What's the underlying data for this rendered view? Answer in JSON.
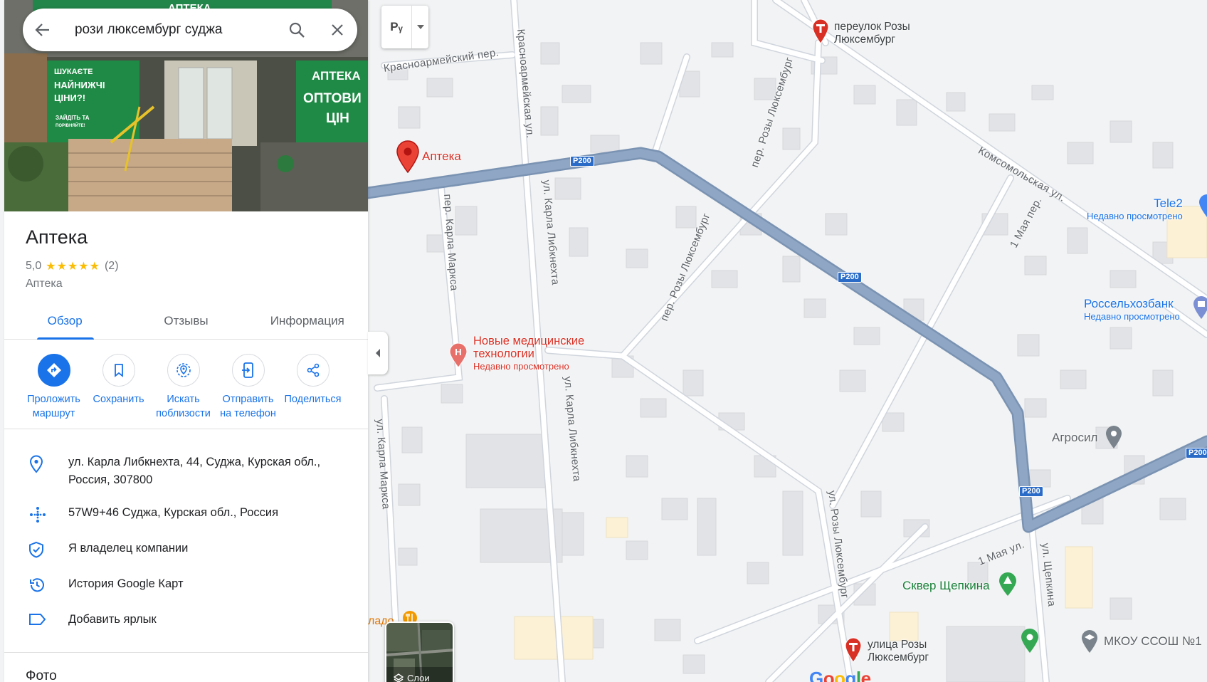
{
  "search": {
    "query": "рози люксембург суджа"
  },
  "photo": {
    "sign_left_lines": [
      "ШУКАЄТЕ",
      "НАЙНИЖЧІ",
      "ЦІНИ?!",
      "ЗАЙДІТЬ ТА",
      "ПОРІВНЯЙТЕ!"
    ],
    "sign_right_lines": [
      "АПТЕКА",
      "ОПТОВИ",
      "ЦІН"
    ],
    "sign_top": "АПТЕКА"
  },
  "place": {
    "title": "Аптека",
    "rating": "5,0",
    "stars": "★★★★★",
    "reviews": "(2)",
    "category": "Аптека"
  },
  "tabs": [
    "Обзор",
    "Отзывы",
    "Информация"
  ],
  "actions": [
    {
      "label": "Проложить\nмаршрут",
      "icon": "directions-icon"
    },
    {
      "label": "Сохранить",
      "icon": "bookmark-icon"
    },
    {
      "label": "Искать\nпоблизости",
      "icon": "nearby-icon"
    },
    {
      "label": "Отправить\nна телефон",
      "icon": "send-to-phone-icon"
    },
    {
      "label": "Поделиться",
      "icon": "share-icon"
    }
  ],
  "info": {
    "address": "ул. Карла Либкнехта, 44, Суджа, Курская обл., Россия, 307800",
    "plus_code": "57W9+46 Суджа, Курская обл., Россия",
    "owner": "Я владелец компании",
    "history": "История Google Карт",
    "label": "Добавить ярлык"
  },
  "photos_title": "Фото",
  "map": {
    "lang_button": "Рᵧ",
    "layers_label": "Слои",
    "google_logo": "Google",
    "streets": {
      "krasnoarmeysky": "Красноармейский пер.",
      "krasnoarmeyskaya": "Красноармейская ул.",
      "karla_libknekhta_1": "ул. Карла Либкнехта",
      "karla_libknekhta_2": "ул. Карла Либкнехта",
      "per_karla_marksa": "пер. Карла Маркса",
      "ul_karla_marksa": "ул. Карла Маркса",
      "per_rozy_1": "пер. Розы Люксембург",
      "per_rozy_2": "пер. Розы Люксембург",
      "ul_rozy": "ул. Розы Люксембург",
      "komsomolskaya": "Комсомольская ул.",
      "may_per": "1 Мая пер.",
      "may_ul": "1 Мая ул.",
      "shchepkina": "ул. Щепкина"
    },
    "road_shield": "Р200",
    "pois": {
      "apteka": "Аптека",
      "pereulok_line1": "переулок Розы",
      "pereulok_line2": "Люксембург",
      "novye_line1": "Новые медицинские",
      "novye_line2": "технологии",
      "recently": "Недавно просмотрено",
      "tele2": "Tele2",
      "rosselkhoz": "Россельхозбанк",
      "agrosil": "Агросил",
      "skver": "Сквер Щепкина",
      "ulitsa_line1": "улица Розы",
      "ulitsa_line2": "Люксембург",
      "mkou": "МКОУ ССОШ №1",
      "cut_label": "ладо"
    }
  }
}
